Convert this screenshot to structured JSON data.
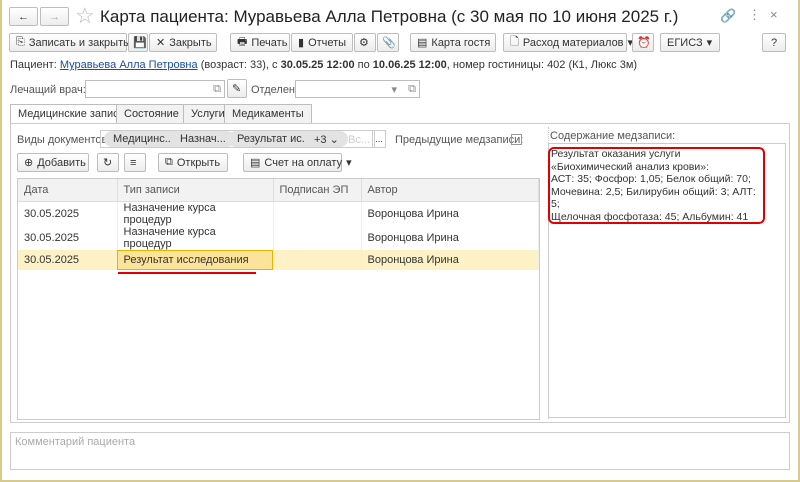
{
  "window": {
    "title": "Карта пациента: Муравьева Алла Петровна (с 30 мая по 10 июня 2025 г.)"
  },
  "toolbar": {
    "save_close": "Записать и закрыть",
    "close": "Закрыть",
    "print": "Печать",
    "reports": "Отчеты",
    "guest_card": "Карта гостя",
    "materials": "Расход материалов",
    "egisz": "ЕГИСЗ",
    "help": "?"
  },
  "patient": {
    "label": "Пациент:",
    "name": "Муравьева Алла Петровна",
    "age": " (возраст: 33), с ",
    "from": "30.05.25 12:00",
    "to_label": " по ",
    "to": "10.06.25 12:00",
    "hotel": ", номер гостиницы: 402 (К1, Люкс 3м)"
  },
  "form": {
    "doctor_label": "Лечащий врач:",
    "doctor_value": "",
    "department_label": "Отделение:",
    "department_value": ""
  },
  "tabs": [
    "Медицинские записи",
    "Состояние",
    "Услуги",
    "Медикаменты"
  ],
  "filter": {
    "label": "Виды документов:",
    "chips": [
      "Медицинс...",
      "Назнач...",
      "Результат ис..."
    ],
    "more": "+3",
    "placeholder": "Вс...",
    "ellipsis": "...",
    "prev_label": "Предыдущие медзаписи:",
    "prev_checked": false
  },
  "actions": {
    "add": "Добавить",
    "open": "Открыть",
    "invoice": "Счет на оплату"
  },
  "table": {
    "columns": [
      "Дата",
      "Тип записи",
      "Подписан ЭП",
      "Автор"
    ],
    "rows": [
      [
        "30.05.2025",
        "Назначение курса процедур",
        "",
        "Воронцова Ирина"
      ],
      [
        "30.05.2025",
        "Назначение курса процедур",
        "",
        "Воронцова Ирина"
      ],
      [
        "30.05.2025",
        "Результат исследования",
        "",
        "Воронцова Ирина"
      ]
    ],
    "selected_row": 2
  },
  "content": {
    "label": "Содержание медзаписи:",
    "text": "Результат оказания услуги «Биохимический анализ крови»:\nАСТ: 35; Фосфор: 1,05; Белок общий: 70;\nМочевина: 2,5; Билирубин общий: 3; АЛТ: 5;\nЩелочная фосфотаза: 45; Альбумин: 41"
  },
  "comment": {
    "placeholder": "Комментарий пациента"
  },
  "colors": {
    "accent_highlight": "#e00000",
    "selected_row": "#fdf2c5",
    "link": "#1a4fa0"
  }
}
